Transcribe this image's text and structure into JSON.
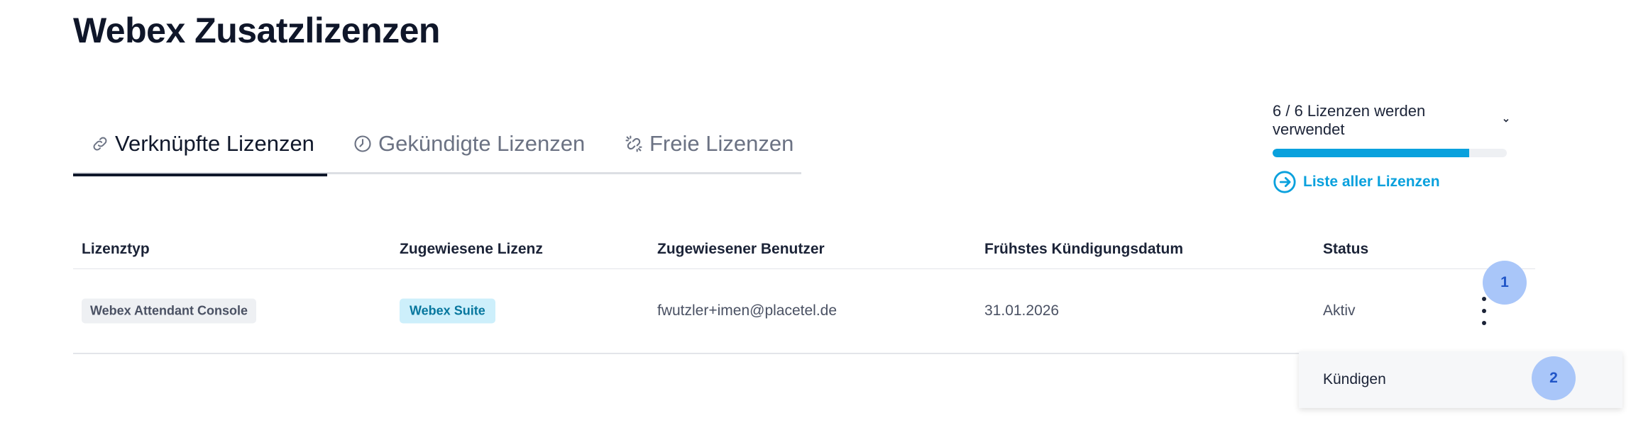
{
  "page": {
    "title": "Webex Zusatzlizenzen"
  },
  "tabs": [
    {
      "label": "Verknüpfte Lizenzen",
      "icon": "link-icon",
      "active": true
    },
    {
      "label": "Gekündigte Lizenzen",
      "icon": "clock-icon",
      "active": false
    },
    {
      "label": "Freie Lizenzen",
      "icon": "broken-link-icon",
      "active": false
    }
  ],
  "usage": {
    "label": "6 / 6 Lizenzen werden verwendet",
    "fill_fraction": 0.84,
    "link_label": "Liste aller Lizenzen",
    "accent": "#0aa1dd"
  },
  "table": {
    "headers": [
      "Lizenztyp",
      "Zugewiesene Lizenz",
      "Zugewiesener Benutzer",
      "Frühstes Kündigungsdatum",
      "Status"
    ],
    "rows": [
      {
        "license_type": "Webex Attendant Console",
        "assigned_license": "Webex Suite",
        "assigned_user": "fwutzler+imen@placetel.de",
        "earliest_cancellation": "31.01.2026",
        "status": "Aktiv"
      }
    ]
  },
  "menu": {
    "items": [
      "Kündigen"
    ]
  },
  "markers": [
    "1",
    "2"
  ]
}
